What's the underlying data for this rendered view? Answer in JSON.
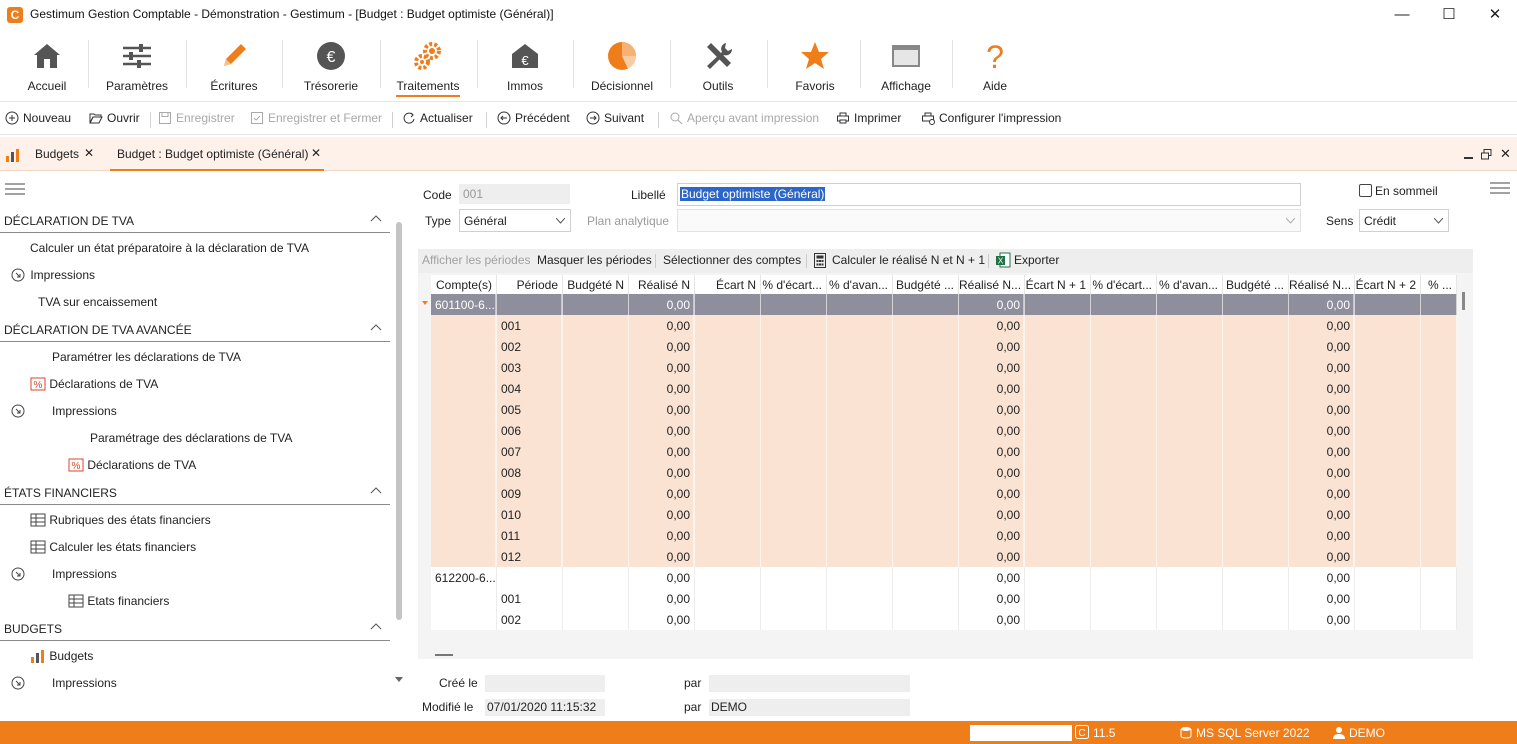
{
  "window": {
    "title": "Gestimum Gestion Comptable - Démonstration - Gestimum - [Budget : Budget optimiste (Général)]",
    "app_icon_letter": "C",
    "minimize": "—",
    "maximize": "☐",
    "close": "✕"
  },
  "ribbon": {
    "accueil": "Accueil",
    "parametres": "Paramètres",
    "ecritures": "Écritures",
    "tresorerie": "Trésorerie",
    "traitements": "Traitements",
    "immos": "Immos",
    "decisionnel": "Décisionnel",
    "outils": "Outils",
    "favoris": "Favoris",
    "affichage": "Affichage",
    "aide": "Aide"
  },
  "toolbar": {
    "nouveau": "Nouveau",
    "ouvrir": "Ouvrir",
    "enregistrer": "Enregistrer",
    "enregistrer_fermer": "Enregistrer et Fermer",
    "actualiser": "Actualiser",
    "precedent": "Précédent",
    "suivant": "Suivant",
    "apercu": "Aperçu avant impression",
    "imprimer": "Imprimer",
    "configurer": "Configurer l'impression"
  },
  "tabs": {
    "tab1": "Budgets",
    "tab2": "Budget : Budget optimiste (Général)",
    "close": "✕"
  },
  "left": {
    "sections": [
      {
        "title": "DÉCLARATION DE TVA"
      },
      {
        "title": "DÉCLARATION DE TVA AVANCÉE"
      },
      {
        "title": "ÉTATS FINANCIERS"
      },
      {
        "title": "BUDGETS"
      }
    ],
    "items": {
      "calc_tva": "Calculer un état préparatoire à la déclaration de TVA",
      "impressions1": "Impressions",
      "tva_encaissement": "TVA sur encaissement",
      "param_decl": "Paramétrer les déclarations de TVA",
      "decl_tva": "Déclarations de TVA",
      "impressions2": "Impressions",
      "param_decl2": "Paramétrage des déclarations de TVA",
      "decl_tva2": "Déclarations de TVA",
      "rubriques": "Rubriques des états financiers",
      "calc_etats": "Calculer les états financiers",
      "impressions3": "Impressions",
      "etats_fin": "Etats financiers",
      "budgets": "Budgets",
      "impressions4": "Impressions"
    }
  },
  "form": {
    "code_label": "Code",
    "code_value": "001",
    "libelle_label": "Libellé",
    "libelle_value": "Budget optimiste (Général)",
    "en_sommeil": "En sommeil",
    "type_label": "Type",
    "type_value": "Général",
    "plan_label": "Plan analytique",
    "sens_label": "Sens",
    "sens_value": "Crédit"
  },
  "grid_tools": {
    "afficher": "Afficher les périodes",
    "masquer": "Masquer les périodes",
    "selectionner": "Sélectionner des comptes",
    "calculer": "Calculer le réalisé N et N + 1",
    "exporter": "Exporter"
  },
  "grid": {
    "columns": [
      "Compte(s)",
      "Période",
      "Budgété N",
      "Réalisé N",
      "Écart N",
      "% d'écart...",
      "% d'avan...",
      "Budgété ...",
      "Réalisé N...",
      "Écart N + 1",
      "% d'écart...",
      "% d'avan...",
      "Budgété ...",
      "Réalisé N...",
      "Écart N + 2",
      "% ..."
    ],
    "rows": [
      {
        "compte": "601100-6...",
        "periode": "",
        "realise_n": "0,00",
        "realise_n1": "0,00",
        "realise_n2": "0,00",
        "kind": "group-selected"
      },
      {
        "compte": "",
        "periode": "001",
        "realise_n": "0,00",
        "realise_n1": "0,00",
        "realise_n2": "0,00",
        "kind": "child"
      },
      {
        "compte": "",
        "periode": "002",
        "realise_n": "0,00",
        "realise_n1": "0,00",
        "realise_n2": "0,00",
        "kind": "child"
      },
      {
        "compte": "",
        "periode": "003",
        "realise_n": "0,00",
        "realise_n1": "0,00",
        "realise_n2": "0,00",
        "kind": "child"
      },
      {
        "compte": "",
        "periode": "004",
        "realise_n": "0,00",
        "realise_n1": "0,00",
        "realise_n2": "0,00",
        "kind": "child"
      },
      {
        "compte": "",
        "periode": "005",
        "realise_n": "0,00",
        "realise_n1": "0,00",
        "realise_n2": "0,00",
        "kind": "child"
      },
      {
        "compte": "",
        "periode": "006",
        "realise_n": "0,00",
        "realise_n1": "0,00",
        "realise_n2": "0,00",
        "kind": "child"
      },
      {
        "compte": "",
        "periode": "007",
        "realise_n": "0,00",
        "realise_n1": "0,00",
        "realise_n2": "0,00",
        "kind": "child"
      },
      {
        "compte": "",
        "periode": "008",
        "realise_n": "0,00",
        "realise_n1": "0,00",
        "realise_n2": "0,00",
        "kind": "child"
      },
      {
        "compte": "",
        "periode": "009",
        "realise_n": "0,00",
        "realise_n1": "0,00",
        "realise_n2": "0,00",
        "kind": "child"
      },
      {
        "compte": "",
        "periode": "010",
        "realise_n": "0,00",
        "realise_n1": "0,00",
        "realise_n2": "0,00",
        "kind": "child"
      },
      {
        "compte": "",
        "periode": "011",
        "realise_n": "0,00",
        "realise_n1": "0,00",
        "realise_n2": "0,00",
        "kind": "child"
      },
      {
        "compte": "",
        "periode": "012",
        "realise_n": "0,00",
        "realise_n1": "0,00",
        "realise_n2": "0,00",
        "kind": "child"
      },
      {
        "compte": "612200-6...",
        "periode": "",
        "realise_n": "0,00",
        "realise_n1": "0,00",
        "realise_n2": "0,00",
        "kind": "group"
      },
      {
        "compte": "",
        "periode": "001",
        "realise_n": "0,00",
        "realise_n1": "0,00",
        "realise_n2": "0,00",
        "kind": "plain"
      },
      {
        "compte": "",
        "periode": "002",
        "realise_n": "0,00",
        "realise_n1": "0,00",
        "realise_n2": "0,00",
        "kind": "plain"
      }
    ]
  },
  "footer": {
    "cree_le": "Créé le",
    "par1": "par",
    "modifie_le": "Modifié le",
    "modifie_value": "07/01/2020 11:15:32",
    "par2": "par",
    "par2_value": "DEMO"
  },
  "status": {
    "version": "11.5",
    "db": "MS SQL Server 2022",
    "user": "DEMO"
  },
  "colors": {
    "accent": "#ef7d1a",
    "selected_row": "#8e8e9c",
    "child_row": "#fbe3d4"
  }
}
